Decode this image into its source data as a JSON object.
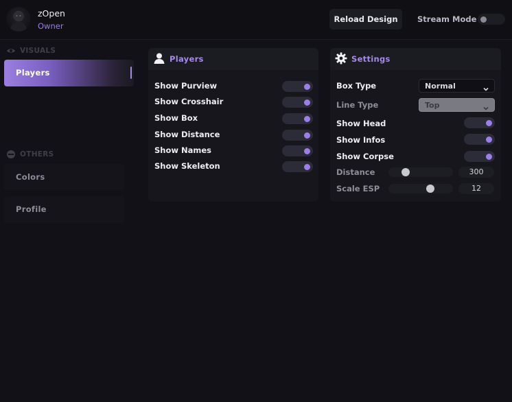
{
  "header": {
    "username": "zOpen",
    "role": "Owner",
    "reload_label": "Reload Design",
    "stream_label": "Stream Mode"
  },
  "sidebar": {
    "sections": [
      {
        "title": "VISUALS",
        "icon": "eye-icon"
      },
      {
        "title": "OTHERS",
        "icon": "circle-icon"
      }
    ],
    "items": [
      {
        "label": "Players",
        "active": true
      },
      {
        "label": "Colors",
        "active": false
      },
      {
        "label": "Profile",
        "active": false
      }
    ]
  },
  "players_panel": {
    "title": "Players",
    "icon": "user-icon",
    "rows": [
      {
        "label": "Show Purview",
        "on": true
      },
      {
        "label": "Show Crosshair",
        "on": true
      },
      {
        "label": "Show Box",
        "on": true
      },
      {
        "label": "Show Distance",
        "on": true
      },
      {
        "label": "Show Names",
        "on": true
      },
      {
        "label": "Show Skeleton",
        "on": true
      }
    ]
  },
  "settings_panel": {
    "title": "Settings",
    "icon": "gear-icon",
    "box_type": {
      "label": "Box Type",
      "value": "Normal"
    },
    "line_type": {
      "label": "Line Type",
      "value": "Top"
    },
    "show_head": {
      "label": "Show Head",
      "on": true
    },
    "show_infos": {
      "label": "Show Infos",
      "on": true
    },
    "show_corpse": {
      "label": "Show Corpse",
      "on": true
    },
    "distance": {
      "label": "Distance",
      "value": "300",
      "fraction": 0.23
    },
    "scale_esp": {
      "label": "Scale ESP",
      "value": "12",
      "fraction": 0.67
    }
  },
  "colors": {
    "accent": "#9c7fe6",
    "background": "#111117"
  }
}
